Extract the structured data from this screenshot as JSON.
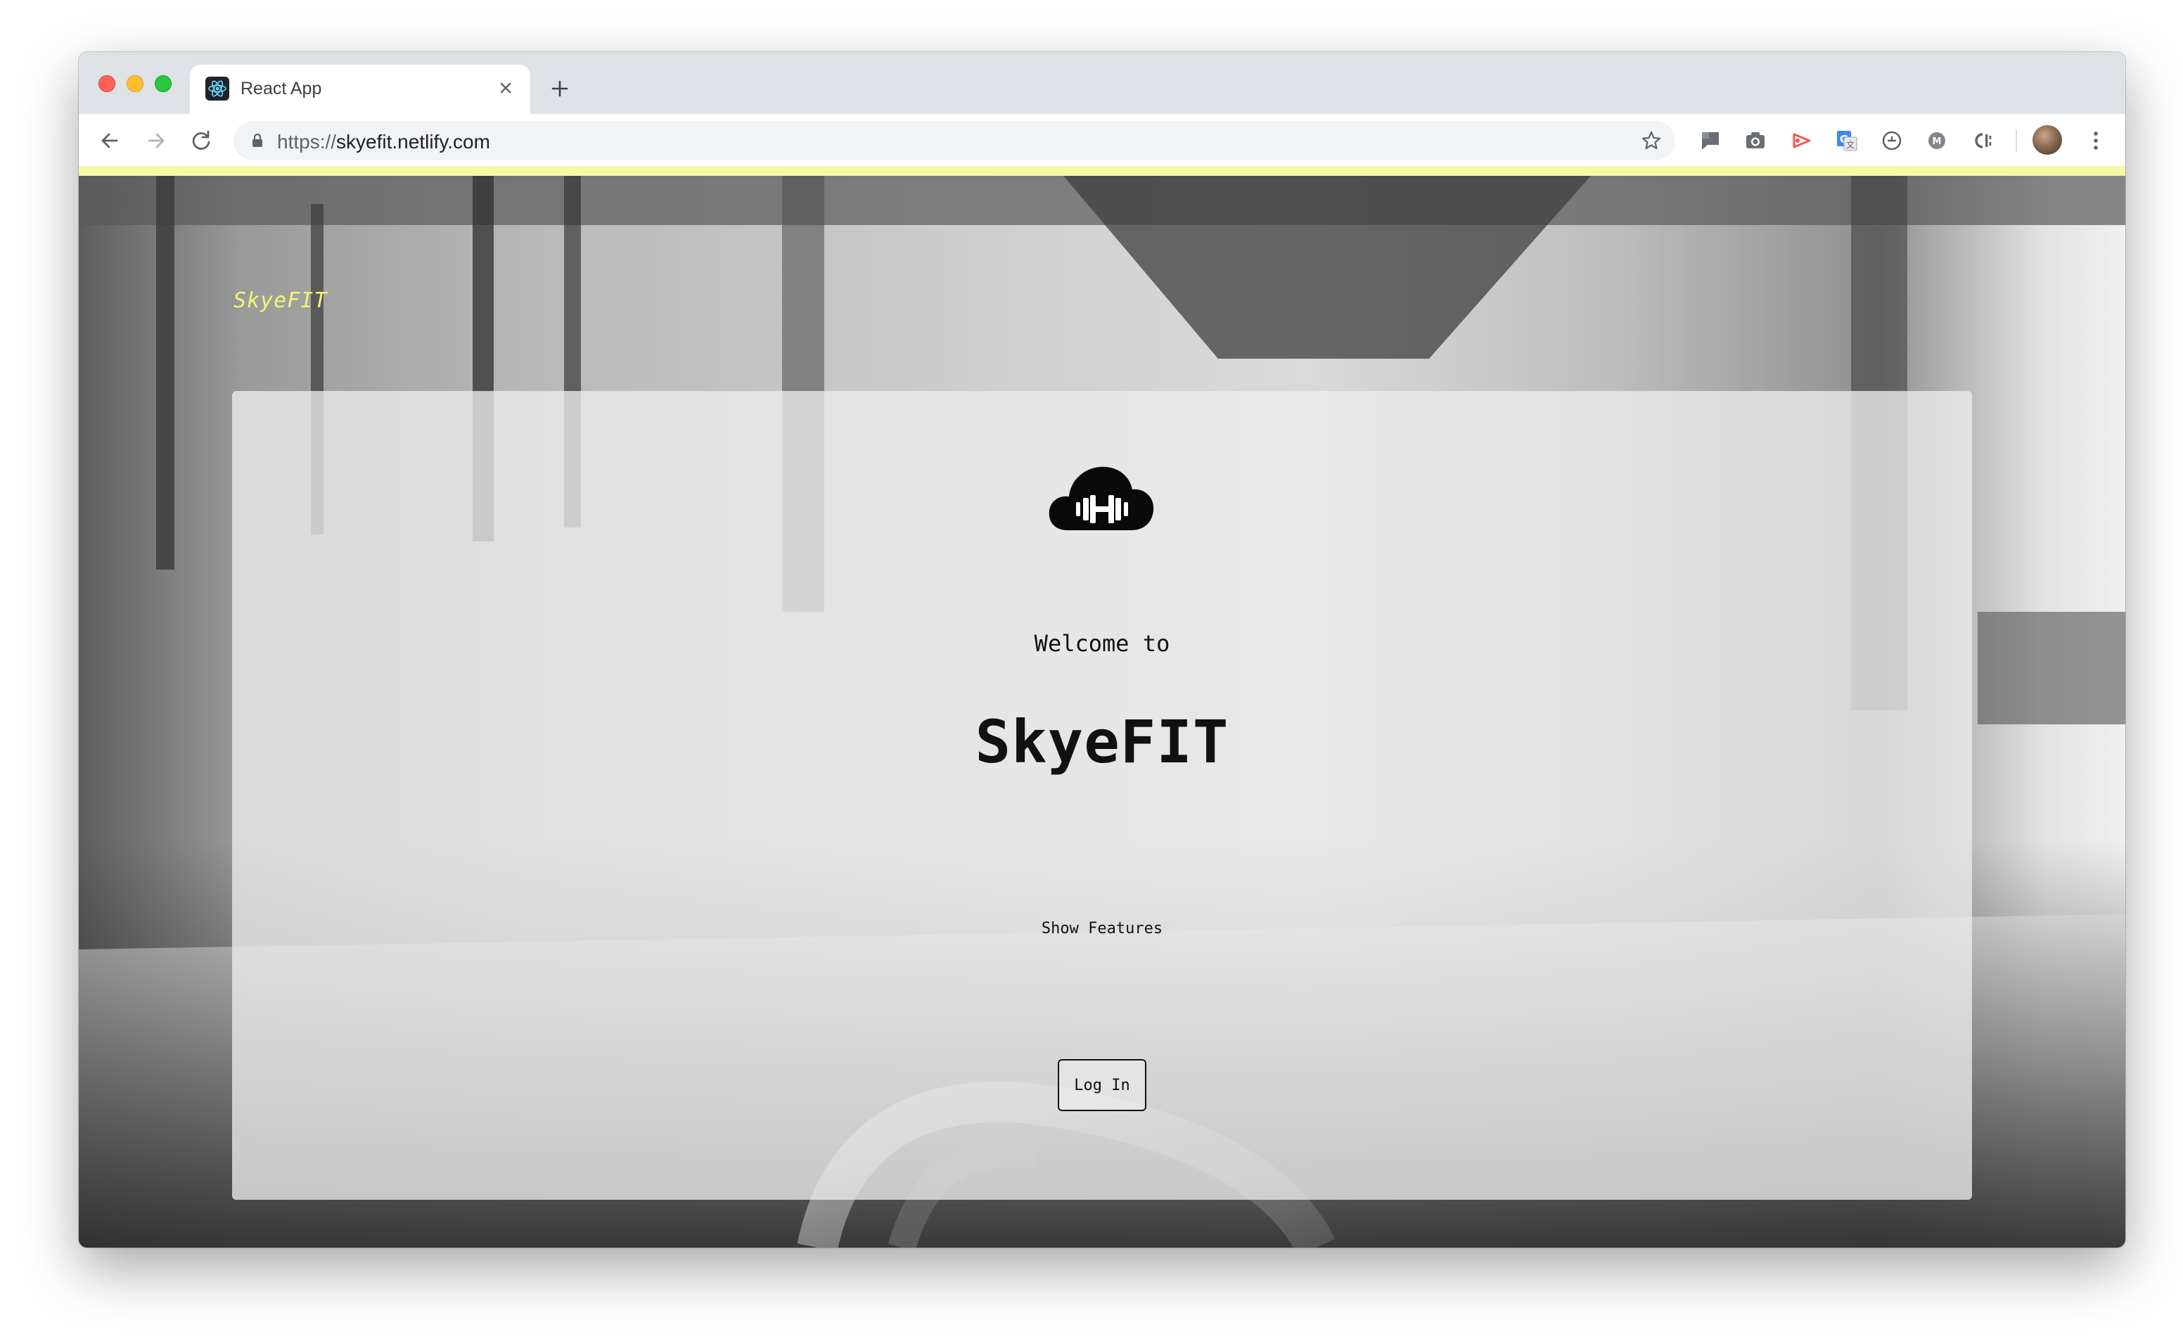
{
  "browser": {
    "tab": {
      "title": "React App",
      "favicon": "react-logo-icon"
    },
    "new_tab_icon": "plus-icon",
    "omnibox": {
      "scheme": "https://",
      "host": "skyefit.netlify.com"
    },
    "nav_icons": [
      "back-arrow-icon",
      "forward-arrow-icon",
      "reload-icon"
    ],
    "extensions": [
      "comment-icon",
      "camera-icon",
      "video-icon",
      "translate-icon",
      "clock-icon",
      "m-circle-icon",
      "cl-icon"
    ],
    "colors": {
      "chrome_bg": "#dee1e6",
      "highlight_bar": "#f7f7a8"
    }
  },
  "page": {
    "nav_brand": "SkyeFIT",
    "card": {
      "logo_icon": "cloud-dumbbell-icon",
      "welcome": "Welcome to",
      "title": "SkyeFIT",
      "show_features": "Show Features",
      "login": "Log In"
    },
    "colors": {
      "brand_yellow": "#f4f47a",
      "text": "#111111"
    }
  }
}
